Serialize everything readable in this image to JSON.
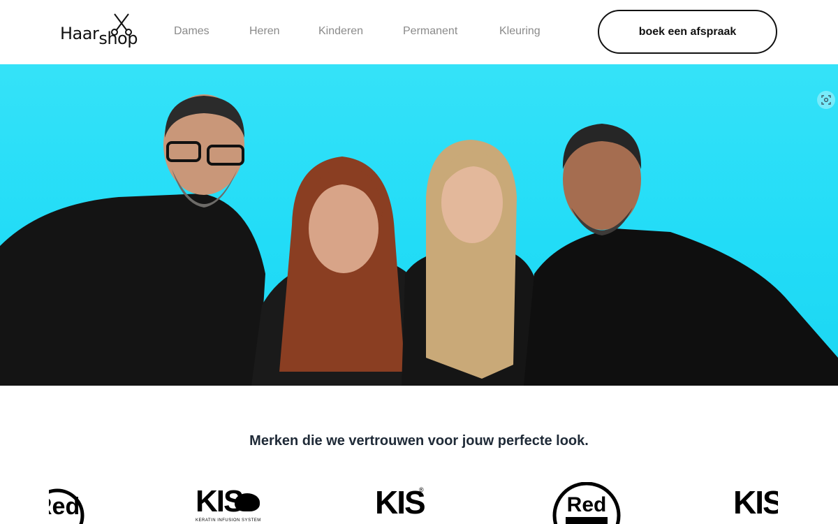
{
  "header": {
    "logo": {
      "text_main": "Haar",
      "text_sub": "shop",
      "icon": "scissors-icon"
    },
    "nav": [
      {
        "label": "Dames"
      },
      {
        "label": "Heren"
      },
      {
        "label": "Kinderen"
      },
      {
        "label": "Permanent"
      },
      {
        "label": "Kleuring"
      }
    ],
    "cta_label": "boek een afspraak"
  },
  "hero": {
    "background_color": "#2ee0f8",
    "focus_icon": "focus-scan-icon"
  },
  "brands": {
    "title": "Merken die we vertrouwen voor jouw perfecte look.",
    "logos": [
      {
        "name": "redken-logo-partial",
        "text": "Red"
      },
      {
        "name": "kis-keratin-logo",
        "text": "KIS",
        "tagline": "KERATIN INFUSION SYSTEM"
      },
      {
        "name": "kis-registered-logo",
        "text": "KIS",
        "mark": "®"
      },
      {
        "name": "red-one-logo",
        "text": "Red"
      },
      {
        "name": "kis-logo-partial",
        "text": "KIS"
      }
    ]
  }
}
